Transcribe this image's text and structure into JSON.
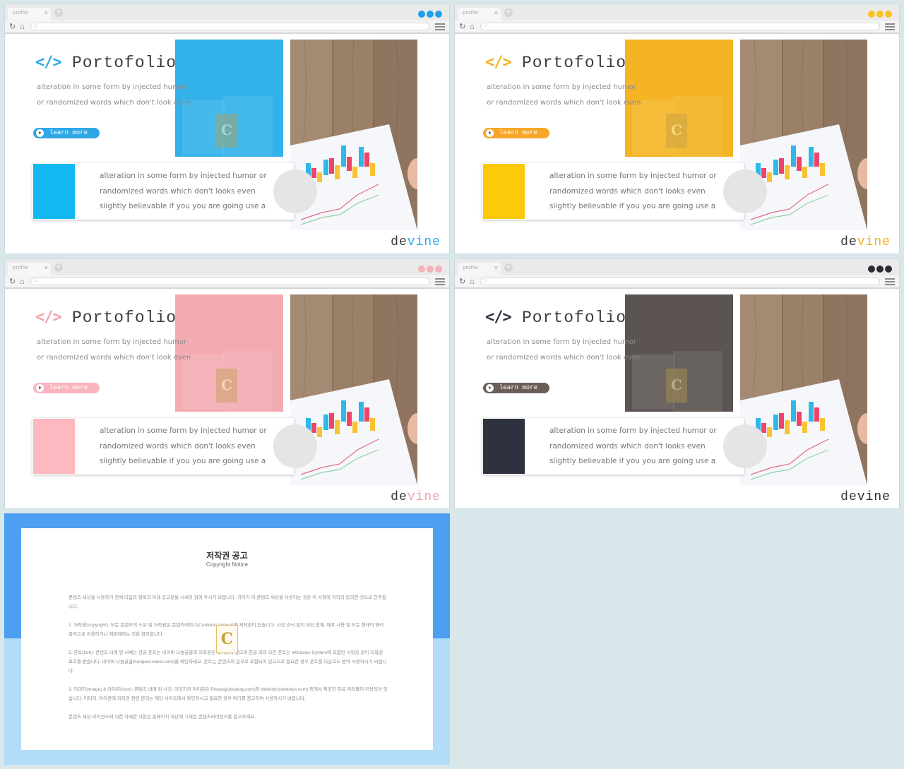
{
  "browser": {
    "tab_label": "profile",
    "tab_close": "×",
    "new_tab": "+",
    "reload": "↻",
    "home": "⌂",
    "search": "○"
  },
  "slide": {
    "logo": "</>",
    "title": "Portofolio",
    "description": "alteration in some form by injected humor or randomized words which don't look even",
    "learn_more": "learn more",
    "card_text": "alteration in some form by injected humor or randomized words which don't looks even slightly believable if you you are going use a",
    "brand_prefix": "de",
    "brand_suffix": "vine",
    "badge": "C"
  },
  "themes": [
    {
      "name": "blue",
      "accent": "#29aae8",
      "swatch": "#14b8f0",
      "cover": "#33b2ea",
      "button": "#2ea7e6",
      "dot": "#1fa0e8"
    },
    {
      "name": "yellow",
      "accent": "#f3b21c",
      "swatch": "#fcc90b",
      "cover": "#f4b424",
      "button": "#f6a72a",
      "dot": "#f9c220"
    },
    {
      "name": "pink",
      "accent": "#f4a0a7",
      "swatch": "#fdb8c0",
      "cover": "#f3abb1",
      "button": "#f8b5bd",
      "dot": "#f5b1b8"
    },
    {
      "name": "dark",
      "accent": "#2c2e3c",
      "swatch": "#2e313e",
      "cover": "#5c5552",
      "button": "#6b5e58",
      "dot": "#2a2c38"
    }
  ],
  "copyright": {
    "title": "저작권 공고",
    "subtitle": "Copyright Notice",
    "paragraphs": [
      "콘텐츠 세상을 사용하기 전에 다음의 항목과 아래 공고문을 시세이 읽어 주시기 바랍니다. 귀하가 이 콘텐츠 세상을 사용하는 것은 이 사항에 귀하의 동의한 것으로 간주됩니다.",
      "1. 저작권(copyright): 모든 콘텐츠의 소유 및 저작권은 콘텐츠테이너(Contentstakeout)에 저작권이 있습니다. 사전 승낙 없이 무단 전재, 배포 사용 및 모든 형태의 영리 목적으로 이용하거나 재판매하는 것을 금지합니다.",
      "2. 폰트(font): 콘텐츠 내에 된 서체는 한글 폰트는 네이버 나눔글꼴의 저작권은 네이버에 있으며 한글 외의 모든 폰트는 Windows System에 포함된 사항과 같이 저작권 보호를 받습니다. 네이버 나눔글꼴(hangeul.naver.com)을 확인하세요. 폰트는 콘텐츠의 일부로 포함되어 있으므로 필요한 경우 폰트를 다운로드 받아 사용하시기 바랍니다.",
      "3. 이미지(image) & 아이콘(icon): 콘텐츠 내에 된 사진, 이미지와 아이콘은 Pixabay(pixabay.com)와 Webolys(webolys.com) 등에서 제공한 무료 저작물이 이용되어 있습니다. 이미지, 아이콘에 저작권 관련 문의는 해당 사이트에서 확인하시고 필요한 경우 여기를 참고하여 사용하시기 바랍니다.",
      "콘텐츠 세상 라이선스에 대한 자세한 사항은 홈페이지 하단에 기재된 콘텐츠라이선스를 참고하세요."
    ]
  }
}
